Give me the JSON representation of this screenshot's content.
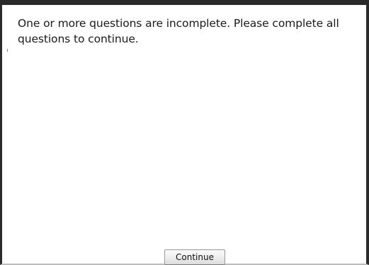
{
  "dialog": {
    "message": "One or more questions are incomplete. Please complete all questions to continue.",
    "continue_label": "Continue"
  }
}
